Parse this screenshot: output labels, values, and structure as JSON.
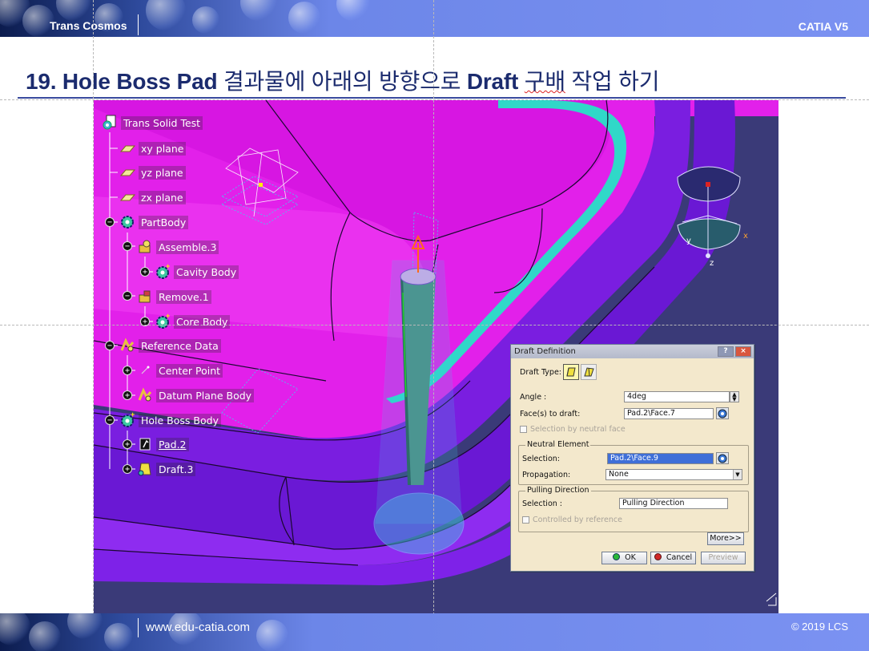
{
  "header": {
    "left_label": "Trans Cosmos",
    "right_label": "CATIA V5"
  },
  "slide": {
    "title_prefix": "19. Hole Boss Pad",
    "title_ko1": " 결과물에 아래의 방향으로 ",
    "title_draft": "Draft",
    "title_ko2": " ",
    "title_wavy": "구배",
    "title_ko3": " 작업 하기"
  },
  "tree": {
    "root": "Trans Solid Test",
    "xy_plane": "xy plane",
    "yz_plane": "yz plane",
    "zx_plane": "zx plane",
    "partbody": "PartBody",
    "assemble": "Assemble.3",
    "cavity": "Cavity Body",
    "remove": "Remove.1",
    "core": "Core Body",
    "reference": "Reference Data",
    "center_point": "Center Point",
    "datum_plane": "Datum Plane Body",
    "hole_boss": "Hole Boss Body",
    "pad": "Pad.2",
    "draft": "Draft.3"
  },
  "compass": {
    "y": "y",
    "x": "x",
    "z": "z"
  },
  "dialog": {
    "title": "Draft Definition",
    "draft_type_label": "Draft Type:",
    "angle_label": "Angle :",
    "angle_value": "4deg",
    "faces_label": "Face(s) to draft:",
    "faces_value": "Pad.2\\Face.7",
    "selection_by_neutral": "Selection by neutral face",
    "neutral_group": "Neutral Element",
    "selection_label": "Selection:",
    "neutral_selection_value": "Pad.2\\Face.9",
    "propagation_label": "Propagation:",
    "propagation_value": "None",
    "pulling_group": "Pulling Direction",
    "pulling_selection_label": "Selection :",
    "pulling_selection_value": "Pulling Direction",
    "controlled_by_reference": "Controlled by reference",
    "more_button": "More>>",
    "ok_button": "OK",
    "cancel_button": "Cancel",
    "preview_button": "Preview"
  },
  "footer": {
    "website": "www.edu-catia.com",
    "copyright": "© 2019 LCS"
  },
  "colors": {
    "brand_blue": "#1b2b6e",
    "part_magenta": "#e020e8",
    "rim_purple": "#7a1ee0",
    "rim_cyan": "#30d8c8",
    "viewport_bg": "#3a3a78"
  }
}
